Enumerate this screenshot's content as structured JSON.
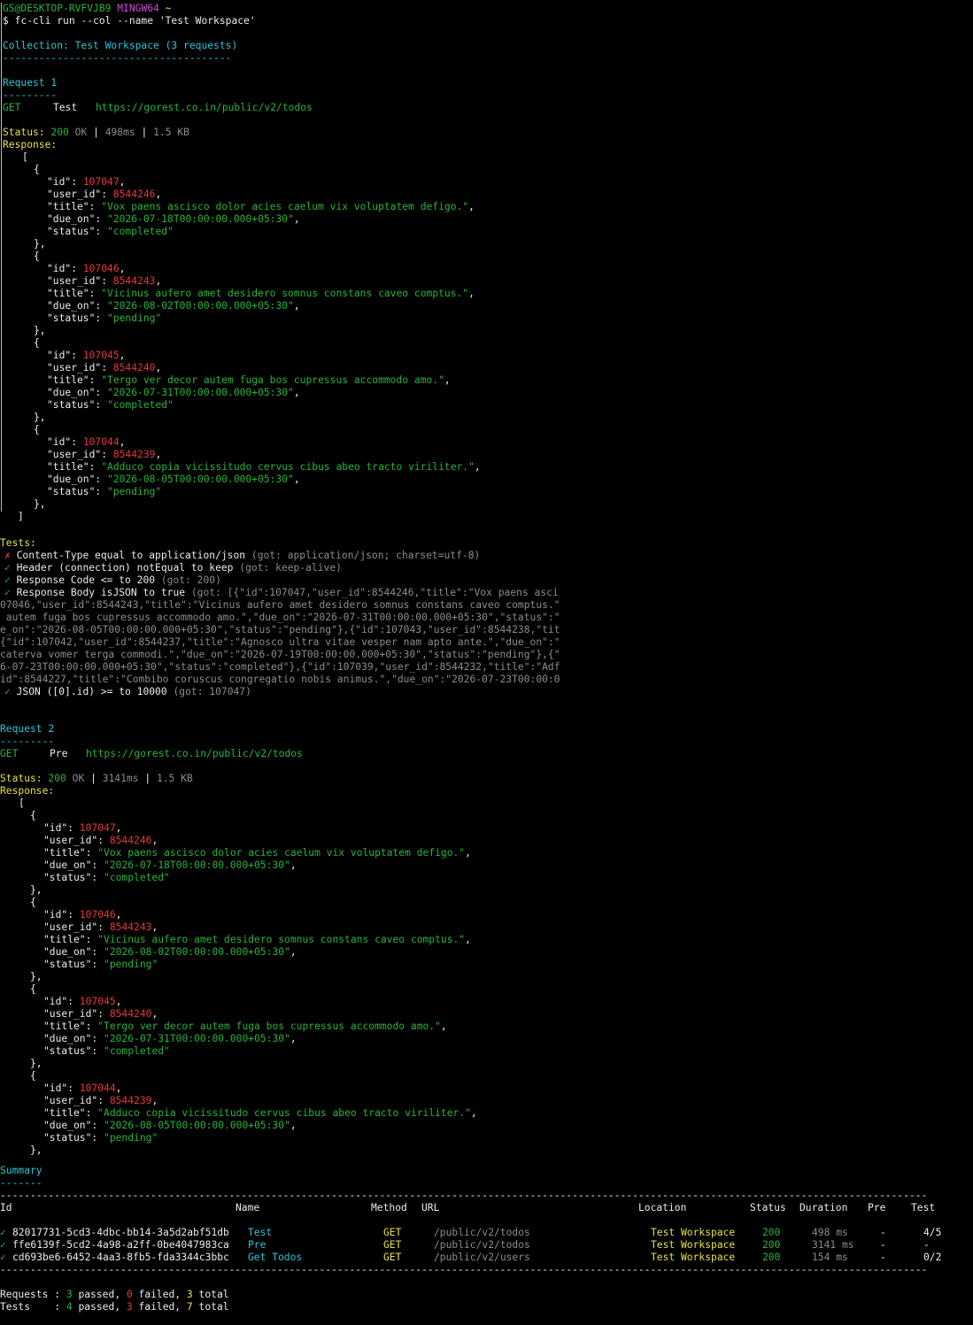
{
  "prompt": {
    "user_host": "GS@DESKTOP-RVFVJB9",
    "shell": "MINGW64",
    "cwd": "~"
  },
  "command": "$ fc-cli run --col --name 'Test Workspace'",
  "collection_line": "Collection: Test Workspace (3 requests)",
  "collection_rule": "--------------------------------------",
  "request1": {
    "heading": "Request 1",
    "rule": "---------",
    "method": "GET",
    "name": "Test",
    "url": "https://gorest.co.in/public/v2/todos",
    "status_label": "Status:",
    "status_code": "200",
    "status_text": "OK",
    "sep": "|",
    "time": "498ms",
    "size": "1.5 KB",
    "response_label": "Response:",
    "items": [
      {
        "id": "107047",
        "user_id": "8544246",
        "title": "\"Vox paens ascisco dolor acies caelum vix voluptatem defigo.\"",
        "due_on": "\"2026-07-18T00:00:00.000+05:30\"",
        "status": "\"completed\""
      },
      {
        "id": "107046",
        "user_id": "8544243",
        "title": "\"Vicinus aufero amet desidero somnus constans caveo comptus.\"",
        "due_on": "\"2026-08-02T00:00:00.000+05:30\"",
        "status": "\"pending\""
      },
      {
        "id": "107045",
        "user_id": "8544240",
        "title": "\"Tergo ver decor autem fuga bos cupressus accommodo amo.\"",
        "due_on": "\"2026-07-31T00:00:00.000+05:30\"",
        "status": "\"completed\""
      },
      {
        "id": "107044",
        "user_id": "8544239",
        "title": "\"Adduco copia vicissitudo cervus cibus abeo tracto viriliter.\"",
        "due_on": "\"2026-08-05T00:00:00.000+05:30\"",
        "status": "\"pending\""
      }
    ],
    "tests_label": "Tests:",
    "tests": [
      {
        "mark": "✗",
        "pass": false,
        "text": "Content-Type equal to application/json",
        "got": "(got: application/json; charset=utf-8)"
      },
      {
        "mark": "✓",
        "pass": true,
        "text": "Header (connection) notEqual to keep",
        "got": "(got: keep-alive)"
      },
      {
        "mark": "✓",
        "pass": true,
        "text": "Response Code <= to 200",
        "got": "(got: 200)"
      },
      {
        "mark": "✓",
        "pass": true,
        "text": "Response Body isJSON to true",
        "got": "(got: [{\"id\":107047,\"user_id\":8544246,\"title\":\"Vox paens asci"
      }
    ],
    "wrap_lines": [
      "07046,\"user_id\":8544243,\"title\":\"Vicinus aufero amet desidero somnus constans caveo comptus.\"",
      " autem fuga bos cupressus accommodo amo.\",\"due_on\":\"2026-07-31T00:00:00.000+05:30\",\"status\":\"",
      "e_on\":\"2026-08-05T00:00:00.000+05:30\",\"status\":\"pending\"},{\"id\":107043,\"user_id\":8544238,\"tit",
      "{\"id\":107042,\"user_id\":8544237,\"title\":\"Agnosco ultra vitae vesper nam apto ante.\",\"due_on\":\"",
      "caterva vomer terga commodi.\",\"due_on\":\"2026-07-19T00:00:00.000+05:30\",\"status\":\"pending\"},{\"",
      "6-07-23T00:00:00.000+05:30\",\"status\":\"completed\"},{\"id\":107039,\"user_id\":8544232,\"title\":\"Adf",
      "id\":8544227,\"title\":\"Combibo coruscus congregatio nobis animus.\",\"due_on\":\"2026-07-23T00:00:0"
    ],
    "last_test": {
      "mark": "✓",
      "text": "JSON ([0].id) >= to 10000",
      "got": "(got: 107047)"
    }
  },
  "request2": {
    "heading": "Request 2",
    "rule": "---------",
    "method": "GET",
    "name": "Pre",
    "url": "https://gorest.co.in/public/v2/todos",
    "status_label": "Status:",
    "status_code": "200",
    "status_text": "OK",
    "sep": "|",
    "time": "3141ms",
    "size": "1.5 KB",
    "response_label": "Response:"
  },
  "json_keys": {
    "id": "\"id\"",
    "user_id": "\"user_id\"",
    "title": "\"title\"",
    "due_on": "\"due_on\"",
    "status": "\"status\""
  },
  "summary": {
    "heading": "Summary",
    "underline": "-------",
    "long_rule": "----------------------------------------------------------------------------------------------------------------------------------------------------------",
    "columns": [
      "Id",
      "Name",
      "Method",
      "URL",
      "Location",
      "Status",
      "Duration",
      "Pre",
      "Test"
    ],
    "rows": [
      {
        "mark": "✓",
        "id": "82017731-5cd3-4dbc-bb14-3a5d2abf51db",
        "name": "Test",
        "method": "GET",
        "url": "/public/v2/todos",
        "location": "Test Workspace",
        "status": "200",
        "duration": "498 ms",
        "pre": "-",
        "test": "4/5"
      },
      {
        "mark": "✓",
        "id": "ffe6139f-5cd2-4a98-a2ff-0be4047983ca",
        "name": "Pre",
        "method": "GET",
        "url": "/public/v2/todos",
        "location": "Test Workspace",
        "status": "200",
        "duration": "3141 ms",
        "pre": "-",
        "test": "-"
      },
      {
        "mark": "✓",
        "id": "cd693be6-6452-4aa3-8fb5-fda3344c3bbc",
        "name": "Get Todos",
        "method": "GET",
        "url": "/public/v2/users",
        "location": "Test Workspace",
        "status": "200",
        "duration": "154 ms",
        "pre": "-",
        "test": "0/2"
      }
    ],
    "requests_line": {
      "label": "Requests :",
      "passed": "3",
      "passed_word": "passed,",
      "failed": "0",
      "failed_word": "failed,",
      "total": "3",
      "total_word": "total"
    },
    "tests_line": {
      "label": "Tests    :",
      "passed": "4",
      "passed_word": "passed,",
      "failed": "3",
      "failed_word": "failed,",
      "total": "7",
      "total_word": "total"
    }
  },
  "colors": {
    "background": "#000000",
    "green": "#29b33b",
    "cyan": "#2ec5d7",
    "yellow": "#e6e04a",
    "magenta": "#c94fd4",
    "red": "#e5383b",
    "gray": "#8c8c8c"
  }
}
